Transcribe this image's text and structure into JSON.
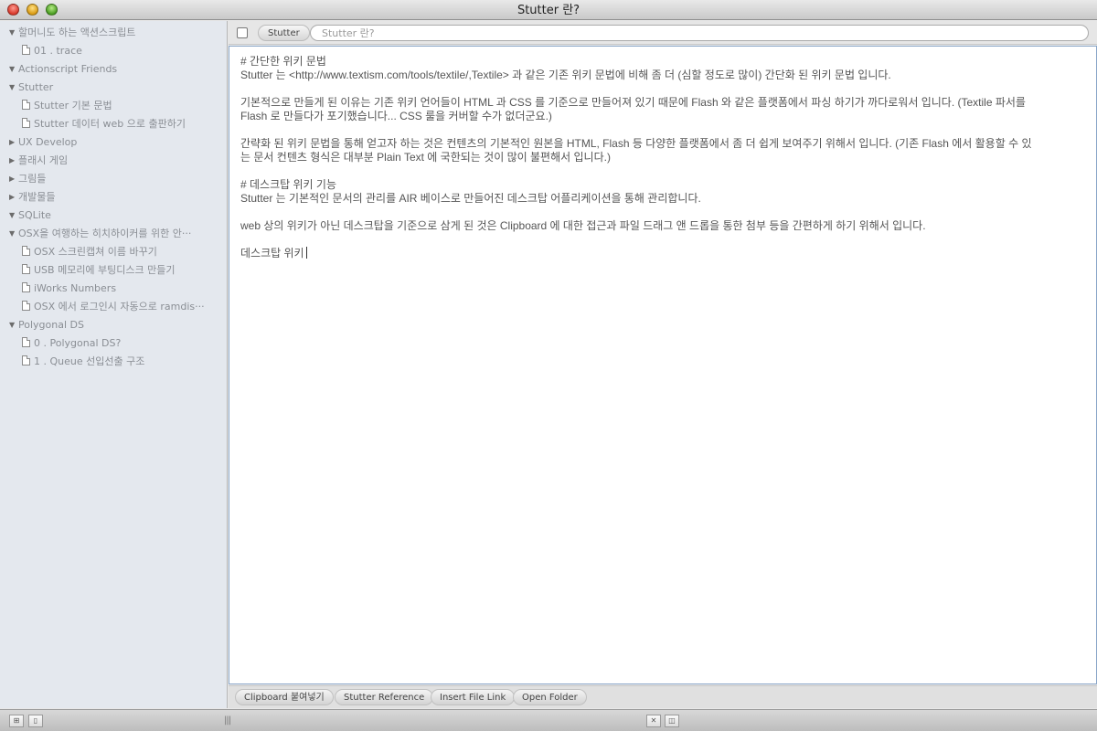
{
  "window": {
    "title": "Stutter 란?"
  },
  "sidebar": {
    "rows": [
      {
        "type": "group",
        "label": "할머니도 하는 액션스크립트",
        "expanded": true
      },
      {
        "type": "leaf",
        "label": "01 . trace"
      },
      {
        "type": "group",
        "label": "Actionscript Friends",
        "expanded": true
      },
      {
        "type": "group",
        "label": "Stutter",
        "expanded": true
      },
      {
        "type": "leaf",
        "label": "Stutter 기본 문법"
      },
      {
        "type": "leaf",
        "label": "Stutter 데이터 web 으로 출판하기"
      },
      {
        "type": "group",
        "label": "UX Develop",
        "expanded": false
      },
      {
        "type": "group",
        "label": "플래시 게임",
        "expanded": false
      },
      {
        "type": "group",
        "label": "그림들",
        "expanded": false
      },
      {
        "type": "group",
        "label": "개발물들",
        "expanded": false
      },
      {
        "type": "group",
        "label": "SQLite",
        "expanded": true
      },
      {
        "type": "group",
        "label": "OSX을 여행하는 히치하이커를 위한 안···",
        "expanded": true
      },
      {
        "type": "leaf",
        "label": "OSX 스크린캡쳐 이름 바꾸기"
      },
      {
        "type": "leaf",
        "label": "USB 메모리에 부팅디스크 만들기"
      },
      {
        "type": "leaf",
        "label": "iWorks Numbers"
      },
      {
        "type": "leaf",
        "label": "OSX 에서 로그인시 자동으로 ramdis···"
      },
      {
        "type": "group",
        "label": "Polygonal DS",
        "expanded": true
      },
      {
        "type": "leaf",
        "label": "0 . Polygonal DS?"
      },
      {
        "type": "leaf",
        "label": "1 . Queue 선입선출 구조"
      }
    ]
  },
  "toolbar": {
    "tag_label": "Stutter",
    "title_value": "Stutter 란?"
  },
  "editor": {
    "lines": [
      "# 간단한 위키 문법",
      "Stutter 는 <http://www.textism.com/tools/textile/,Textile> 과 같은 기존 위키 문법에 비해 좀 더 (심할 정도로 많이) 간단화 된 위키 문법 입니다.",
      "",
      "기본적으로 만들게 된 이유는 기존 위키 언어들이 HTML 과 CSS 를 기준으로 만들어져 있기 때문에 Flash 와 같은 플랫폼에서 파싱 하기가 까다로워서 입니다. (Textile 파서를",
      "Flash 로 만들다가 포기했습니다... CSS 룰을 커버할 수가 없더군요.)",
      "",
      "간략화 된 위키 문법을 통해 얻고자 하는 것은 컨텐츠의 기본적인 원본을 HTML, Flash 등 다양한 플랫폼에서 좀 더 쉽게 보여주기 위해서 입니다. (기존 Flash 에서 활용할 수 있",
      "는 문서 컨텐츠 형식은 대부분 Plain Text 에 국한되는 것이 많이 불편해서 입니다.)",
      "",
      "# 데스크탑 위키 기능",
      "Stutter 는 기본적인 문서의 관리를 AIR 베이스로 만들어진 데스크탑 어플리케이션을 통해 관리합니다.",
      "",
      "web 상의 위키가 아닌 데스크탑을 기준으로 삼게 된 것은 Clipboard 에 대한 접근과 파일 드래그 앤 드롭을 통한 첨부 등을 간편하게 하기 위해서 입니다.",
      "",
      "데스크탑 위키"
    ]
  },
  "bottom_buttons": {
    "clipboard": "Clipboard 붙여넣기",
    "reference": "Stutter Reference",
    "insert_link": "Insert File Link",
    "open_folder": "Open Folder"
  },
  "statusbar": {
    "left_btn1_icon": "hierarchy-icon",
    "left_btn2_icon": "new-document-icon",
    "right_btn1_icon": "close-icon",
    "right_btn2_icon": "window-icon"
  }
}
